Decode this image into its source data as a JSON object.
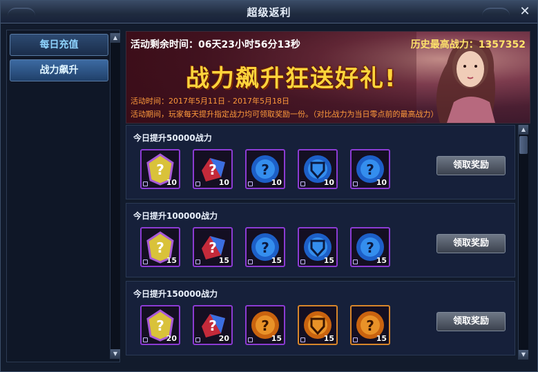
{
  "window": {
    "title": "超级返利",
    "close_icon": "close-icon"
  },
  "sidebar": {
    "items": [
      {
        "label": "每日充值"
      },
      {
        "label": "战力飙升"
      }
    ]
  },
  "banner": {
    "countdown": "活动剩余时间：06天23小时56分13秒",
    "history_label": "历史最高战力：",
    "history_value": "1357352",
    "slogan": "战力飙升狂送好礼!",
    "activity_time": "活动时间：2017年5月11日 - 2017年5月18日",
    "activity_desc": "活动期间，玩家每天提升指定战力均可领取奖励一份。（对比战力为当日零点前的最高战力）"
  },
  "rows": [
    {
      "title": "今日提升50000战力",
      "button": "领取奖励",
      "items": [
        {
          "icon": "yellow-mystery-gem-icon",
          "count": "10",
          "frame": "purple"
        },
        {
          "icon": "red-blue-gem-icon",
          "count": "10",
          "frame": "purple"
        },
        {
          "icon": "blue-mystery-orb-icon",
          "count": "10",
          "frame": "purple"
        },
        {
          "icon": "blue-shield-orb-icon",
          "count": "10",
          "frame": "purple"
        },
        {
          "icon": "blue-mystery-orb-icon",
          "count": "10",
          "frame": "purple"
        }
      ]
    },
    {
      "title": "今日提升100000战力",
      "button": "领取奖励",
      "items": [
        {
          "icon": "yellow-mystery-gem-icon",
          "count": "15",
          "frame": "purple"
        },
        {
          "icon": "red-blue-gem-icon",
          "count": "15",
          "frame": "purple"
        },
        {
          "icon": "blue-mystery-orb-icon",
          "count": "15",
          "frame": "purple"
        },
        {
          "icon": "blue-shield-orb-icon",
          "count": "15",
          "frame": "purple"
        },
        {
          "icon": "blue-mystery-orb-icon",
          "count": "15",
          "frame": "purple"
        }
      ]
    },
    {
      "title": "今日提升150000战力",
      "button": "领取奖励",
      "items": [
        {
          "icon": "yellow-mystery-gem-icon",
          "count": "20",
          "frame": "purple"
        },
        {
          "icon": "red-blue-gem-icon",
          "count": "20",
          "frame": "purple"
        },
        {
          "icon": "orange-mystery-orb-icon",
          "count": "15",
          "frame": "purple"
        },
        {
          "icon": "orange-shield-orb-icon",
          "count": "15",
          "frame": "orange"
        },
        {
          "icon": "orange-mystery-orb-icon",
          "count": "15",
          "frame": "orange"
        }
      ]
    }
  ],
  "colors": {
    "accent": "#8fd4ff",
    "highlight": "#ffe36b",
    "notice": "#ff9a3c",
    "epic_frame": "#8c3bd3",
    "legend_frame": "#d8862a"
  }
}
